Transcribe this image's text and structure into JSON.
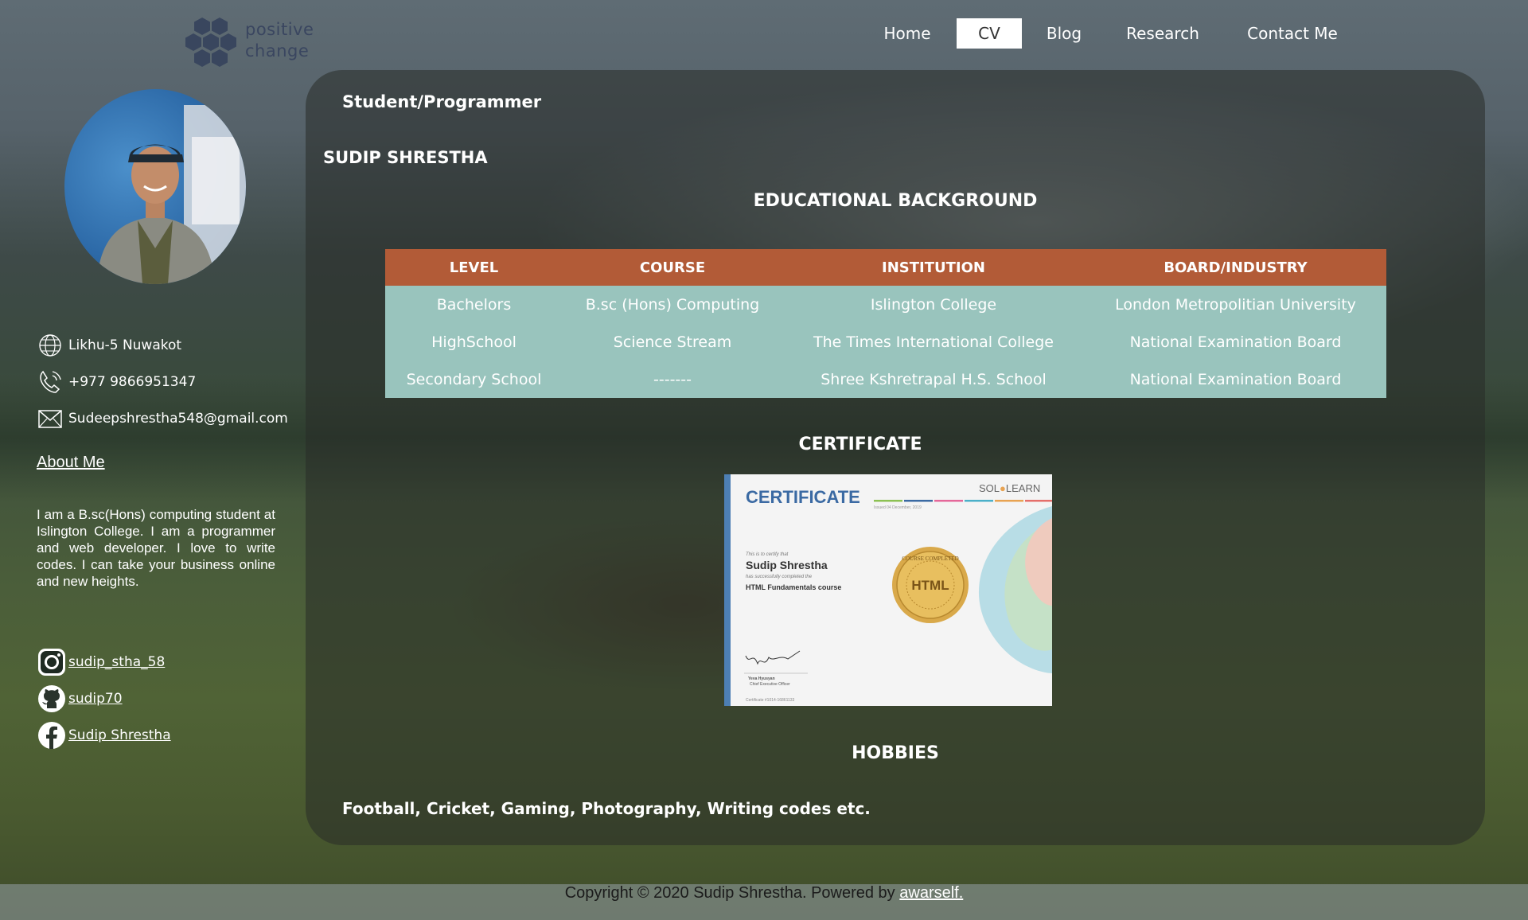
{
  "logo": {
    "line1": "positive",
    "line2": "change"
  },
  "nav": {
    "items": [
      {
        "label": "Home",
        "active": false
      },
      {
        "label": "CV",
        "active": true
      },
      {
        "label": "Blog",
        "active": false
      },
      {
        "label": "Research",
        "active": false
      },
      {
        "label": "Contact Me",
        "active": false
      }
    ]
  },
  "sidebar": {
    "location": "Likhu-5 Nuwakot",
    "phone": "+977 9866951347",
    "email": "Sudeepshrestha548@gmail.com",
    "about_heading": "About Me",
    "about_text": "I am a B.sc(Hons) computing student at Islington College. I am a programmer and web developer. I love to write codes. I can take your business online and new heights.",
    "social": {
      "instagram": "sudip_stha_58",
      "github": "sudip70",
      "facebook": "Sudip Shrestha"
    }
  },
  "main": {
    "role": "Student/Programmer",
    "name": "SUDIP SHRESTHA",
    "education_title": "EDUCATIONAL BACKGROUND",
    "table": {
      "headers": [
        "LEVEL",
        "COURSE",
        "INSTITUTION",
        "BOARD/INDUSTRY"
      ],
      "rows": [
        [
          "Bachelors",
          "B.sc (Hons) Computing",
          "Islington College",
          "London Metropolitian University"
        ],
        [
          "HighSchool",
          "Science Stream",
          "The Times International College",
          "National Examination Board"
        ],
        [
          "Secondary School",
          "-------",
          "Shree Kshretrapal H.S. School",
          "National Examination Board"
        ]
      ]
    },
    "certificate_title": "CERTIFICATE",
    "certificate": {
      "heading": "CERTIFICATE",
      "issuer_a": "SOL",
      "issuer_b": "LEARN",
      "issued": "Issued 04 December, 2019",
      "certify": "This is to certify that",
      "recipient": "Sudip Shrestha",
      "completed": "has successfully completed the",
      "course": "HTML Fundamentals course",
      "seal": "HTML",
      "seal_ring": "COURSE COMPLETED",
      "signer": "Yeva Hyusyan",
      "signer_title": "Chief Executive Officer",
      "cert_no": "Certificate #1014-16861133"
    },
    "hobbies_title": "HOBBIES",
    "hobbies": "Football, Cricket, Gaming, Photography, Writing codes etc."
  },
  "footer": {
    "text": "Copyright © 2020 Sudip Shrestha. Powered by ",
    "link": "awarself."
  },
  "colors": {
    "table_header": "#b25b37",
    "table_body": "#99c4bd",
    "nav_active_bg": "#ffffff"
  }
}
